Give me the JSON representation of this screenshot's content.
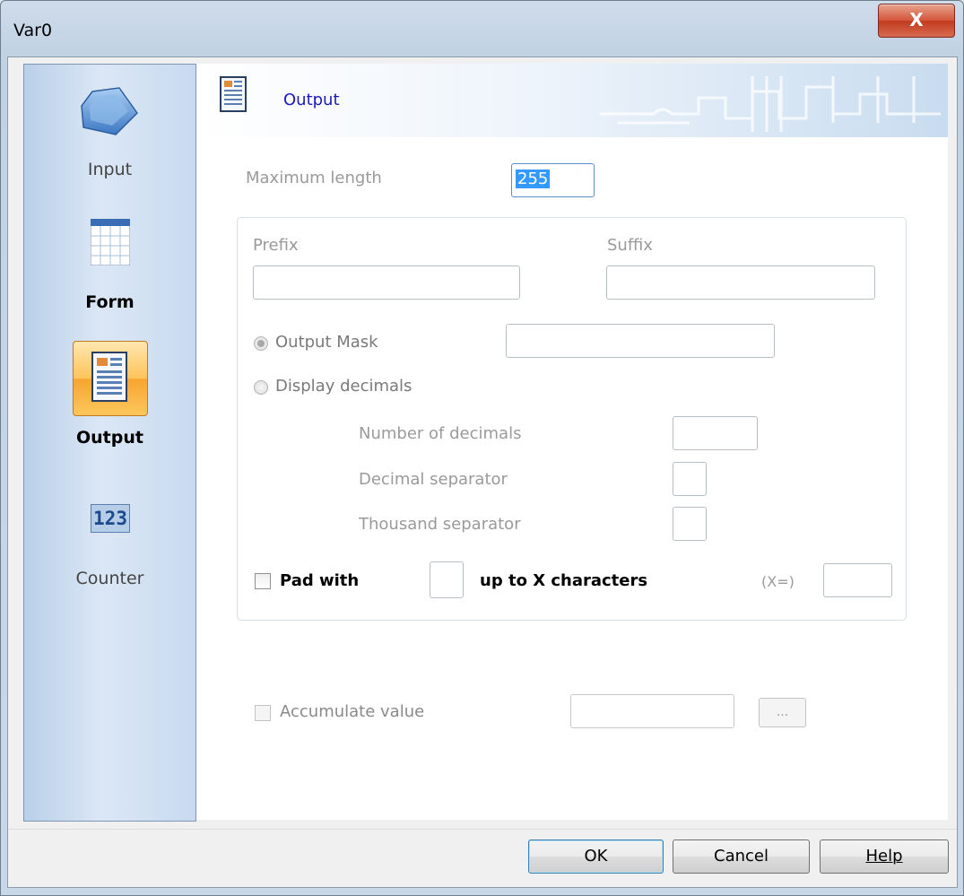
{
  "window": {
    "title": "Var0",
    "close_glyph": "X"
  },
  "sidebar": {
    "items": [
      {
        "label": "Input",
        "icon": "input-keyboard-icon",
        "active": false,
        "bold": false
      },
      {
        "label": "Form",
        "icon": "form-grid-icon",
        "active": false,
        "bold": true
      },
      {
        "label": "Output",
        "icon": "output-document-icon",
        "active": true,
        "bold": true
      },
      {
        "label": "Counter",
        "icon": "counter-123-icon",
        "active": false,
        "bold": false
      }
    ],
    "counter_icon_text": "123"
  },
  "header": {
    "title": "Output",
    "icon": "output-document-icon"
  },
  "form": {
    "max_length_label": "Maximum length",
    "max_length_value": "255",
    "prefix_label": "Prefix",
    "prefix_value": "",
    "suffix_label": "Suffix",
    "suffix_value": "",
    "output_mask_label": "Output Mask",
    "output_mask_value": "",
    "output_mask_selected": true,
    "display_decimals_label": "Display decimals",
    "display_decimals_selected": false,
    "num_decimals_label": "Number of decimals",
    "num_decimals_value": "",
    "decimal_sep_label": "Decimal separator",
    "decimal_sep_value": "",
    "thousand_sep_label": "Thousand separator",
    "thousand_sep_value": "",
    "pad_with_label": "Pad with",
    "pad_with_checked": false,
    "pad_char_value": "",
    "up_to_label": "up to X characters",
    "x_eq_label": "(X=)",
    "x_value": "",
    "accumulate_label": "Accumulate value",
    "accumulate_checked": false,
    "accumulate_value": "",
    "browse_label": "..."
  },
  "footer": {
    "ok_label": "OK",
    "cancel_label": "Cancel",
    "help_label": "Help"
  },
  "colors": {
    "header_title": "#1a1ab8",
    "active_nav": "#f7a531",
    "disabled_text": "#9a9a9a"
  }
}
